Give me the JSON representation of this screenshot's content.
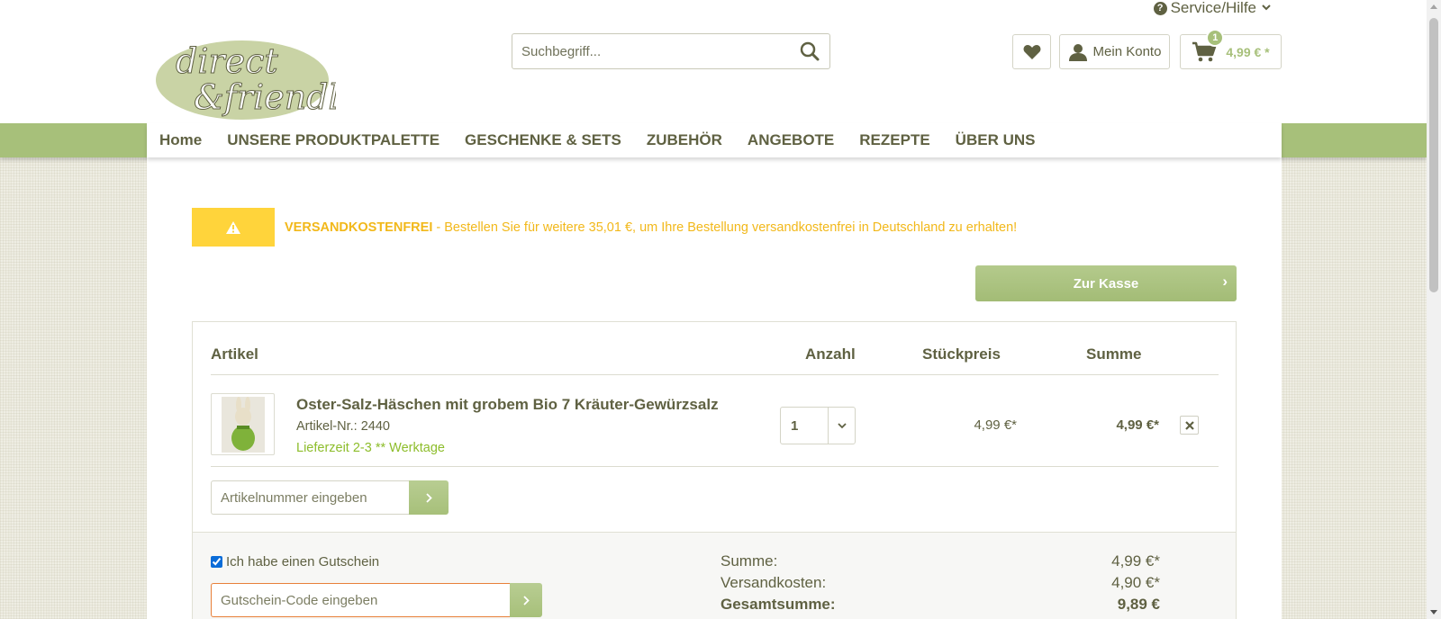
{
  "header": {
    "service_label": "Service/Hilfe",
    "logo_text_line1": "direct",
    "logo_text_line2": "&friendly",
    "search_placeholder": "Suchbegriff...",
    "account_label": "Mein Konto",
    "cart_count": "1",
    "cart_total": "4,99 € *"
  },
  "nav": {
    "items": [
      "Home",
      "UNSERE PRODUKTPALETTE",
      "GESCHENKE & SETS",
      "ZUBEHÖR",
      "ANGEBOTE",
      "REZEPTE",
      "ÜBER UNS"
    ]
  },
  "notice": {
    "bold": "VERSANDKOSTENFREI",
    "text": " - Bestellen Sie für weitere 35,01 €, um Ihre Bestellung versandkostenfrei in Deutschland zu erhalten!"
  },
  "checkout_button": "Zur Kasse",
  "table": {
    "headers": {
      "article": "Artikel",
      "quantity": "Anzahl",
      "unit_price": "Stückpreis",
      "sum": "Summe"
    },
    "items": [
      {
        "name": "Oster-Salz-Häschen mit grobem Bio 7 Kräuter-Gewürzsalz",
        "sku": "Artikel-Nr.: 2440",
        "delivery": "Lieferzeit 2-3 ** Werktage",
        "quantity": "1",
        "unit_price": "4,99 €*",
        "sum": "4,99 €*"
      }
    ],
    "article_input_placeholder": "Artikelnummer eingeben"
  },
  "coupon": {
    "checkbox_label": "Ich habe einen Gutschein",
    "checked": true,
    "input_placeholder": "Gutschein-Code eingeben"
  },
  "totals": {
    "subtotal_label": "Summe:",
    "subtotal_value": "4,99 €*",
    "shipping_label": "Versandkosten:",
    "shipping_value": "4,90 €*",
    "grand_label": "Gesamtsumme:",
    "grand_value": "9,89 €"
  },
  "colors": {
    "brand_green": "#a7c07a",
    "text_olive": "#5f6142",
    "warning_yellow": "#ffd43b",
    "warning_text": "#f2b81a",
    "delivery_green": "#8dbd2b"
  }
}
